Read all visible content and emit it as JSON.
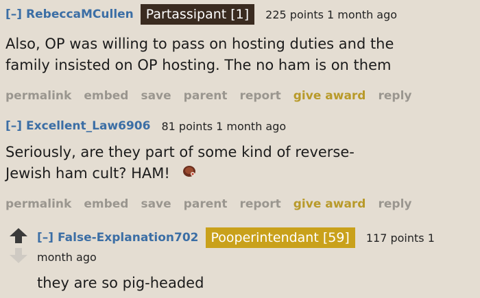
{
  "comments": [
    {
      "toggle": "[–]",
      "author": "RebeccaMCullen",
      "flair": "Partassipant [1]",
      "score": "225 points 1 month ago",
      "body_lines": [
        "Also, OP was willing to pass on hosting duties and the",
        "family insisted on OP hosting. The no ham is on them"
      ],
      "buttons": [
        "permalink",
        "embed",
        "save",
        "parent",
        "report",
        "give award",
        "reply"
      ]
    },
    {
      "toggle": "[–]",
      "author": "Excellent_Law6906",
      "score": "81 points 1 month ago",
      "body_lines": [
        "Seriously, are they part of some kind of reverse-",
        "Jewish ham cult? HAM!"
      ],
      "buttons": [
        "permalink",
        "embed",
        "save",
        "parent",
        "report",
        "give award",
        "reply"
      ]
    },
    {
      "toggle": "[–]",
      "author": "False-Explanation702",
      "flair": "Pooperintendant [59]",
      "score_line1": "117 points 1",
      "score_line2": "month ago",
      "body_lines": [
        "they are so pig-headed"
      ]
    }
  ],
  "colors": {
    "background": "#e4ddd2",
    "link": "#3b6ea5",
    "award": "#b89a2a",
    "button": "#9a968f"
  },
  "icons": {
    "ham": "ham-emoji-icon",
    "up": "upvote-arrow-icon",
    "down": "downvote-arrow-icon"
  }
}
